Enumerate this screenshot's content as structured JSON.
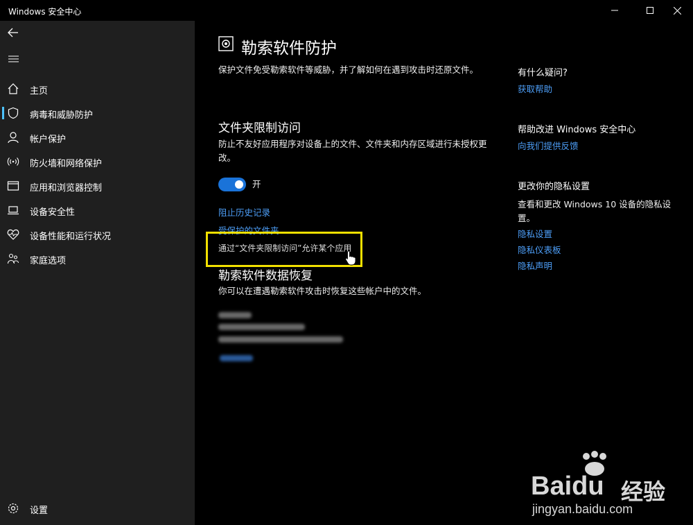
{
  "window": {
    "title": "Windows 安全中心"
  },
  "sidebar": {
    "items": [
      {
        "label": "主页",
        "icon": "home-icon"
      },
      {
        "label": "病毒和威胁防护",
        "icon": "shield-icon",
        "active": true
      },
      {
        "label": "帐户保护",
        "icon": "person-icon"
      },
      {
        "label": "防火墙和网络保护",
        "icon": "wireless-icon"
      },
      {
        "label": "应用和浏览器控制",
        "icon": "app-window-icon"
      },
      {
        "label": "设备安全性",
        "icon": "laptop-icon"
      },
      {
        "label": "设备性能和运行状况",
        "icon": "heart-pulse-icon"
      },
      {
        "label": "家庭选项",
        "icon": "family-icon"
      }
    ],
    "settings_label": "设置"
  },
  "main": {
    "title": "勒索软件防护",
    "description": "保护文件免受勒索软件等威胁，并了解如何在遇到攻击时还原文件。",
    "cfa": {
      "heading": "文件夹限制访问",
      "description": "防止不友好应用程序对设备上的文件、文件夹和内存区域进行未授权更改。",
      "toggle_label": "开",
      "toggle_on": true,
      "links": [
        "阻止历史记录",
        "受保护的文件夹",
        "通过“文件夹限制访问”允许某个应用"
      ]
    },
    "recovery": {
      "heading": "勒索软件数据恢复",
      "description": "你可以在遭遇勒索软件攻击时恢复这些帐户中的文件。"
    }
  },
  "right": {
    "questions": {
      "heading": "有什么疑问?",
      "link": "获取帮助"
    },
    "improve": {
      "heading": "帮助改进 Windows 安全中心",
      "link": "向我们提供反馈"
    },
    "privacy": {
      "heading": "更改你的隐私设置",
      "description": "查看和更改 Windows 10 设备的隐私设置。",
      "links": [
        "隐私设置",
        "隐私仪表板",
        "隐私声明"
      ]
    }
  },
  "watermark": {
    "brand": "Baidu",
    "suffix": "经验",
    "url": "jingyan.baidu.com"
  },
  "colors": {
    "accent": "#1a73d9",
    "link": "#4d9ef7",
    "highlight": "#f2e000",
    "sidebar": "#1f1f1f"
  }
}
